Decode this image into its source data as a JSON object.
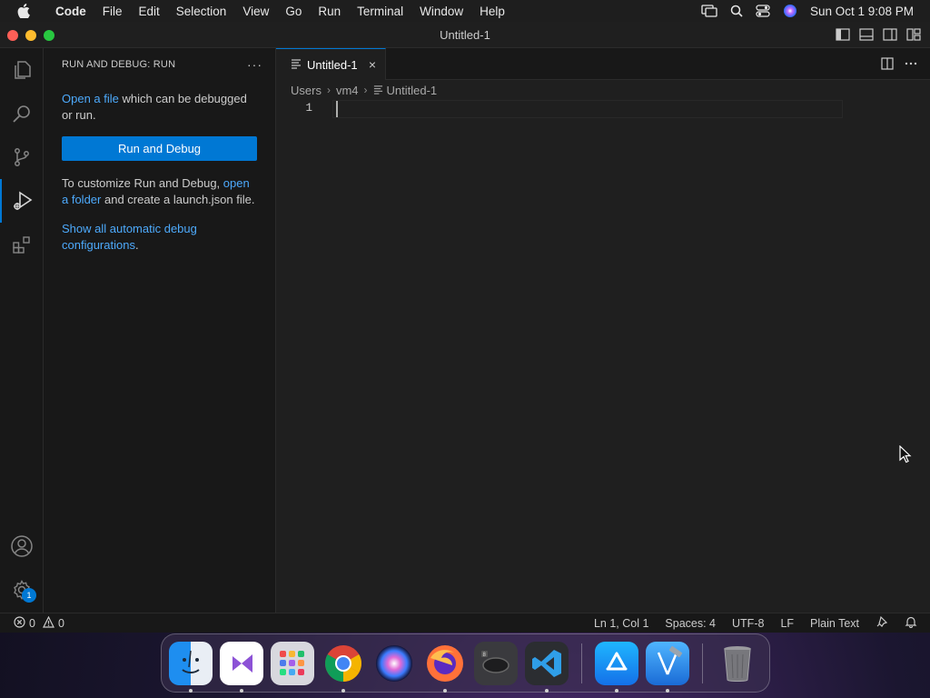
{
  "menubar": {
    "app_name": "Code",
    "items": [
      "File",
      "Edit",
      "Selection",
      "View",
      "Go",
      "Run",
      "Terminal",
      "Window",
      "Help"
    ],
    "clock": "Sun Oct 1  9:08 PM"
  },
  "window": {
    "title": "Untitled-1"
  },
  "activity_bar": {
    "settings_badge": "1"
  },
  "sidebar": {
    "title": "RUN AND DEBUG: RUN",
    "more": "···",
    "para1_link": "Open a file",
    "para1_text": " which can be debugged or run.",
    "run_button": "Run and Debug",
    "para2_text": "To customize Run and Debug, ",
    "para2_link": "open a folder",
    "para2_tail": " and create a launch.json file.",
    "para3_link": "Show all automatic debug configurations",
    "para3_tail": "."
  },
  "editor": {
    "tab_label": "Untitled-1",
    "tab_close": "×",
    "breadcrumb": [
      "Users",
      "vm4",
      "Untitled-1"
    ],
    "line_number": "1"
  },
  "statusbar": {
    "errors": "0",
    "warnings": "0",
    "position": "Ln 1, Col 1",
    "spaces": "Spaces: 4",
    "encoding": "UTF-8",
    "eol": "LF",
    "language": "Plain Text"
  },
  "dock": {
    "apps": [
      "finder-icon",
      "visual-studio-icon",
      "launchpad-icon",
      "chrome-icon",
      "siri-icon",
      "firefox-icon",
      "gpu-app-icon",
      "vscode-icon",
      "app-store-icon",
      "xcode-icon",
      "trash-icon"
    ]
  },
  "colors": {
    "accent": "#0078d4",
    "link": "#4daafc",
    "sidebar_bg": "#181818",
    "editor_bg": "#1f1f1f"
  }
}
